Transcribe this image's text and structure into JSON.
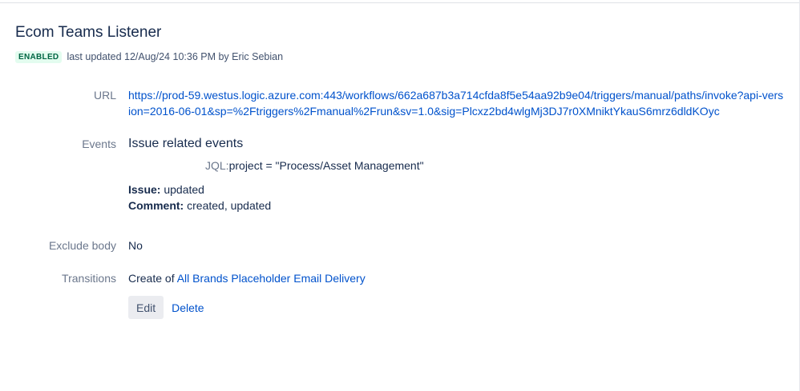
{
  "listener": {
    "title": "Ecom Teams Listener",
    "status": "ENABLED",
    "updated_text": "last updated 12/Aug/24 10:36 PM by Eric Sebian"
  },
  "details": {
    "url_label": "URL",
    "url_value": "https://prod-59.westus.logic.azure.com:443/workflows/662a687b3a714cfda8f5e54aa92b9e04/triggers/manual/paths/invoke?api-version=2016-06-01&sp=%2Ftriggers%2Fmanual%2Frun&sv=1.0&sig=Plcxz2bd4wlgMj3DJ7r0XMniktYkauS6mrz6dldKOyc",
    "events_label": "Events",
    "events_title": "Issue related events",
    "jql_key": "JQL:",
    "jql_value": "project = \"Process/Asset Management\"",
    "issue_key": "Issue:",
    "issue_value": " updated",
    "comment_key": "Comment:",
    "comment_value": " created, updated",
    "exclude_body_label": "Exclude body",
    "exclude_body_value": "No",
    "transitions_label": "Transitions",
    "transitions_prefix": "Create of ",
    "transitions_link": "All Brands Placeholder Email Delivery"
  },
  "actions": {
    "edit_label": "Edit",
    "delete_label": "Delete"
  },
  "colors": {
    "link": "#0052cc",
    "text": "#172b4d",
    "label": "#6b778c",
    "badge_bg": "#e3fcef",
    "badge_text": "#006644",
    "button_bg": "#ebecf0"
  }
}
